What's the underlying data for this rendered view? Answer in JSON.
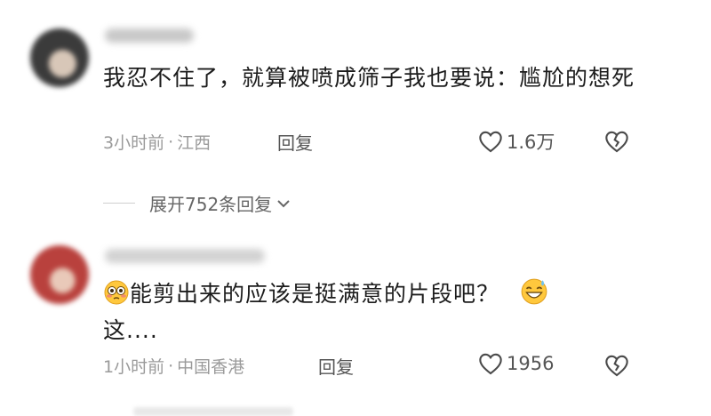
{
  "comments": [
    {
      "text": "我忍不住了，就算被喷成筛子我也要说：尴尬的想死",
      "time": "3小时前",
      "separator": "·",
      "location": "江西",
      "reply_label": "回复",
      "likes": "1.6万",
      "expand_label": "展开752条回复",
      "avatar_color": "#4a4a4a"
    },
    {
      "text_line1": "能剪出来的应该是挺满意的片段吧？",
      "text_line2": "这....",
      "time": "1小时前",
      "separator": "·",
      "location": "中国香港",
      "reply_label": "回复",
      "likes": "1956",
      "avatar_color": "#b9413d"
    }
  ],
  "icons": {
    "like": "heart-outline-icon",
    "dislike": "broken-heart-icon",
    "expand": "chevron-down-icon",
    "emoji_start": "flushed-face-emoji",
    "emoji_end": "grin-sweat-emoji"
  }
}
